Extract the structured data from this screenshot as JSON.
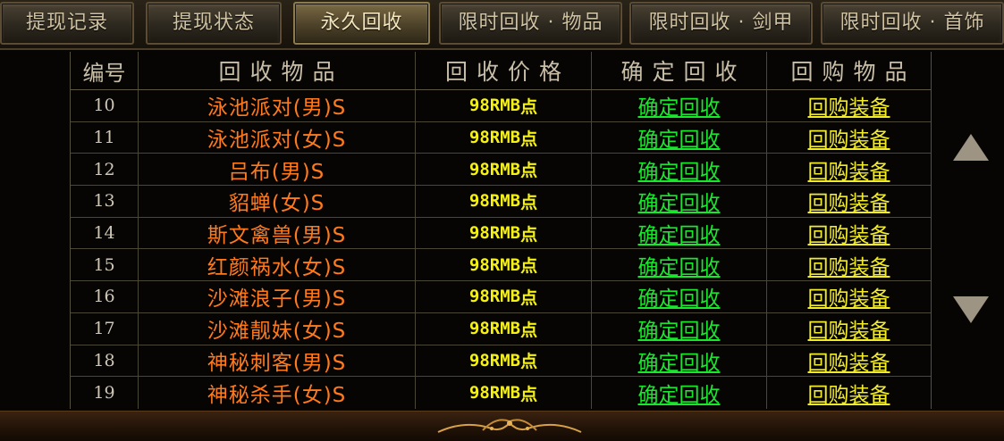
{
  "tabs": [
    {
      "label": "提现记录",
      "active": false
    },
    {
      "label": "提现状态",
      "active": false
    },
    {
      "label": "永久回收",
      "active": true
    },
    {
      "label": "限时回收 · 物品",
      "active": false
    },
    {
      "label": "限时回收 · 剑甲",
      "active": false
    },
    {
      "label": "限时回收 · 首饰",
      "active": false
    }
  ],
  "table": {
    "headers": [
      "编号",
      "回收物品",
      "回收价格",
      "确定回收",
      "回购物品"
    ],
    "rows": [
      {
        "id": "10",
        "item": "泳池派对(男)S",
        "price": "98RMB",
        "unit": "点",
        "confirm": "确定回收",
        "buyback": "回购装备"
      },
      {
        "id": "11",
        "item": "泳池派对(女)S",
        "price": "98RMB",
        "unit": "点",
        "confirm": "确定回收",
        "buyback": "回购装备"
      },
      {
        "id": "12",
        "item": "吕布(男)S",
        "price": "98RMB",
        "unit": "点",
        "confirm": "确定回收",
        "buyback": "回购装备"
      },
      {
        "id": "13",
        "item": "貂蝉(女)S",
        "price": "98RMB",
        "unit": "点",
        "confirm": "确定回收",
        "buyback": "回购装备"
      },
      {
        "id": "14",
        "item": "斯文禽兽(男)S",
        "price": "98RMB",
        "unit": "点",
        "confirm": "确定回收",
        "buyback": "回购装备"
      },
      {
        "id": "15",
        "item": "红颜祸水(女)S",
        "price": "98RMB",
        "unit": "点",
        "confirm": "确定回收",
        "buyback": "回购装备"
      },
      {
        "id": "16",
        "item": "沙滩浪子(男)S",
        "price": "98RMB",
        "unit": "点",
        "confirm": "确定回收",
        "buyback": "回购装备"
      },
      {
        "id": "17",
        "item": "沙滩靓妹(女)S",
        "price": "98RMB",
        "unit": "点",
        "confirm": "确定回收",
        "buyback": "回购装备"
      },
      {
        "id": "18",
        "item": "神秘刺客(男)S",
        "price": "98RMB",
        "unit": "点",
        "confirm": "确定回收",
        "buyback": "回购装备"
      },
      {
        "id": "19",
        "item": "神秘杀手(女)S",
        "price": "98RMB",
        "unit": "点",
        "confirm": "确定回收",
        "buyback": "回购装备"
      }
    ]
  },
  "scroll": {
    "up_icon": "triangle-up-icon",
    "down_icon": "triangle-down-icon"
  },
  "colors": {
    "item_text": "#ff7a1c",
    "price_text": "#f6f114",
    "confirm_link": "#18e82c",
    "buyback_link": "#f2ec28",
    "header_text": "#c9bea8"
  }
}
